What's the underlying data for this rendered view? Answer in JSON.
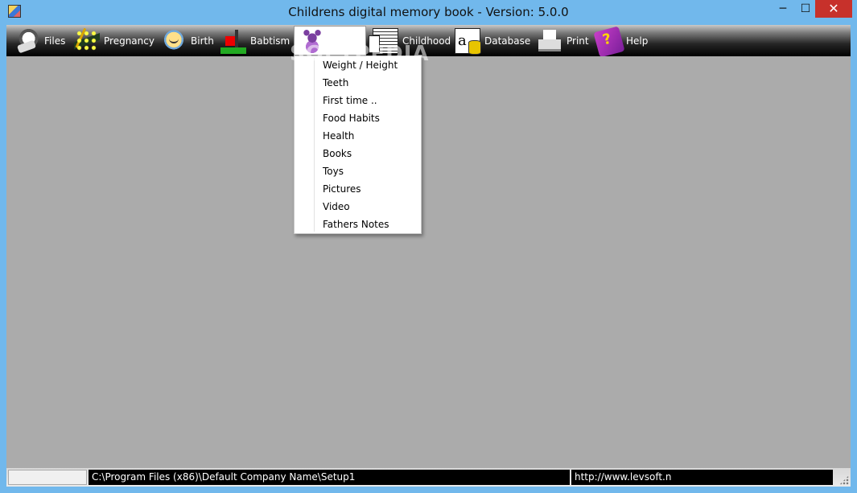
{
  "window": {
    "title": "Childrens digital memory book -  Version: 5.0.0",
    "minimize_glyph": "─",
    "maximize_glyph": "☐",
    "close_glyph": "✕"
  },
  "menubar": {
    "items": [
      {
        "label": "Files",
        "icon": "files-icon"
      },
      {
        "label": "Pregnancy",
        "icon": "pregnancy-icon"
      },
      {
        "label": "Birth",
        "icon": "baby-face-icon"
      },
      {
        "label": "Babtism",
        "icon": "church-icon"
      },
      {
        "label": "",
        "icon": "teddy-bear-icon"
      },
      {
        "label": "Childhood",
        "icon": "notebook-icon"
      },
      {
        "label": "Database",
        "icon": "database-icon"
      },
      {
        "label": "Print",
        "icon": "printer-icon"
      },
      {
        "label": "Help",
        "icon": "help-book-icon"
      }
    ]
  },
  "dropdown": {
    "items": [
      "Weight / Height",
      "Teeth",
      "First time ..",
      "Food Habits",
      "Health",
      "Books",
      "Toys",
      "Pictures",
      "Video",
      "Fathers Notes"
    ]
  },
  "watermark": "SOFTPEDIA",
  "statusbar": {
    "panel1": "",
    "path": "C:\\Program Files (x86)\\Default Company Name\\Setup1",
    "url": "http://www.levsoft.no"
  },
  "colors": {
    "titlebar": "#71b8ec",
    "close_button": "#c7312b",
    "client_background": "#ababab",
    "menubar_dark": "#000000"
  }
}
